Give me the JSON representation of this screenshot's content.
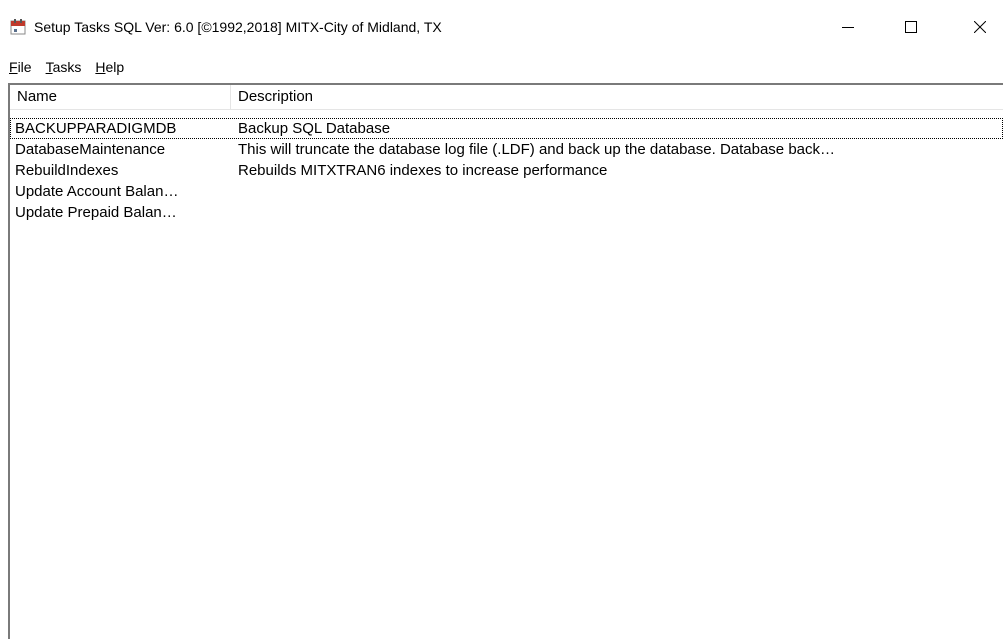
{
  "window": {
    "title": "Setup Tasks SQL Ver: 6.0 [©1992,2018]  MITX-City of Midland, TX",
    "icon": "calendar-icon",
    "caption_buttons": {
      "minimize": "minimize-icon",
      "maximize": "maximize-icon",
      "close": "close-icon"
    },
    "accent_color": "#b22222"
  },
  "menu": {
    "items": [
      {
        "accel": "F",
        "rest": "ile"
      },
      {
        "accel": "T",
        "rest": "asks"
      },
      {
        "accel": "H",
        "rest": "elp"
      }
    ]
  },
  "list": {
    "columns": {
      "name": "Name",
      "description": "Description"
    },
    "rows": [
      {
        "name": "BACKUPPARADIGMDB",
        "description": "Backup SQL Database"
      },
      {
        "name": "DatabaseMaintenance",
        "description": "This will truncate the database log file (.LDF) and back up the database.  Database back…"
      },
      {
        "name": "RebuildIndexes",
        "description": "Rebuilds MITXTRAN6 indexes to increase performance"
      },
      {
        "name": "Update Account Balan…",
        "description": ""
      },
      {
        "name": "Update Prepaid Balan…",
        "description": ""
      }
    ]
  }
}
